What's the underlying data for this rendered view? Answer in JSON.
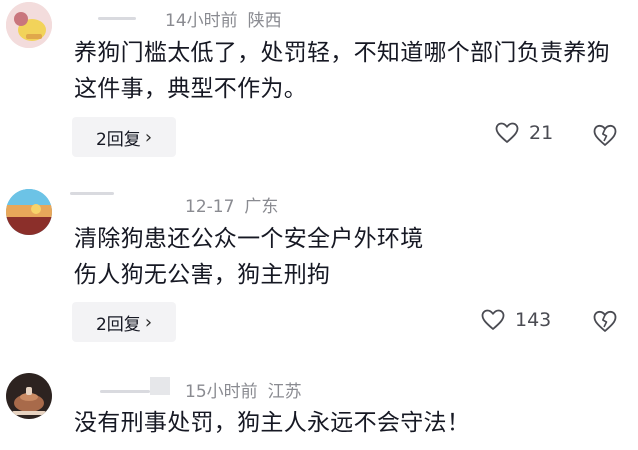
{
  "comments": [
    {
      "time": "14小时前",
      "location": "陕西",
      "text": "养狗门槛太低了，处罚轻，不知道哪个部门负责养狗这件事，典型不作为。",
      "reply_label": "2回复",
      "likes": "21",
      "avatar_colors": [
        "#f3dcdc",
        "#c9767d",
        "#f2d35a"
      ]
    },
    {
      "time": "12-17",
      "location": "广东",
      "text": "清除狗患还公众一个安全户外环境\n伤人狗无公害，狗主刑拘",
      "reply_label": "2回复",
      "likes": "143",
      "avatar_colors": [
        "#4ab0d9",
        "#e8a75a",
        "#8b2f2a"
      ]
    },
    {
      "time": "15小时前",
      "location": "江苏",
      "text": "没有刑事处罚，狗主人永远不会守法！",
      "avatar_colors": [
        "#2d2320",
        "#a86a4a",
        "#e7d3c1"
      ]
    }
  ],
  "icons": {
    "like": "heart-outline-icon",
    "dislike": "broken-heart-icon",
    "chevron": "chevron-right-icon"
  },
  "colors": {
    "meta_text": "#8a8b91",
    "body_text": "#161823",
    "reply_bg": "#f3f3f5"
  }
}
